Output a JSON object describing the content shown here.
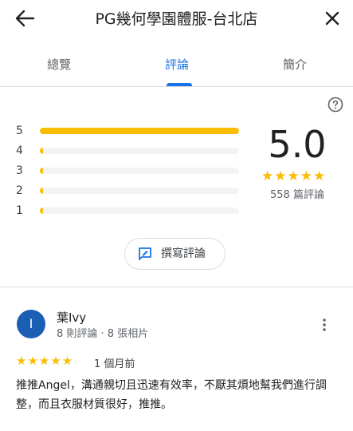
{
  "header": {
    "title": "PG幾何學園體服-台北店"
  },
  "tabs": [
    {
      "label": "總覽",
      "active": false
    },
    {
      "label": "評論",
      "active": true
    },
    {
      "label": "簡介",
      "active": false
    }
  ],
  "rating_breakdown": [
    {
      "stars": "5",
      "fraction": 1.0
    },
    {
      "stars": "4",
      "fraction": 0.0
    },
    {
      "stars": "3",
      "fraction": 0.0
    },
    {
      "stars": "2",
      "fraction": 0.0
    },
    {
      "stars": "1",
      "fraction": 0.0
    }
  ],
  "summary": {
    "average": "5.0",
    "stars": "★★★★★",
    "count": "558 篇評論"
  },
  "write_review": {
    "label": "撰寫評論"
  },
  "review": {
    "avatar_letter": "I",
    "name": "葉Ivy",
    "meta": "8 則評論 · 8 張相片",
    "stars": "★★★★★",
    "time": "1 個月前",
    "text": "推推Angel，溝通親切且迅速有效率，不厭其煩地幫我們進行調整，而且衣服材質很好，推推。"
  },
  "colors": {
    "accent": "#1a73e8",
    "star": "#fbbc04",
    "avatar": "#1a5fb4"
  }
}
